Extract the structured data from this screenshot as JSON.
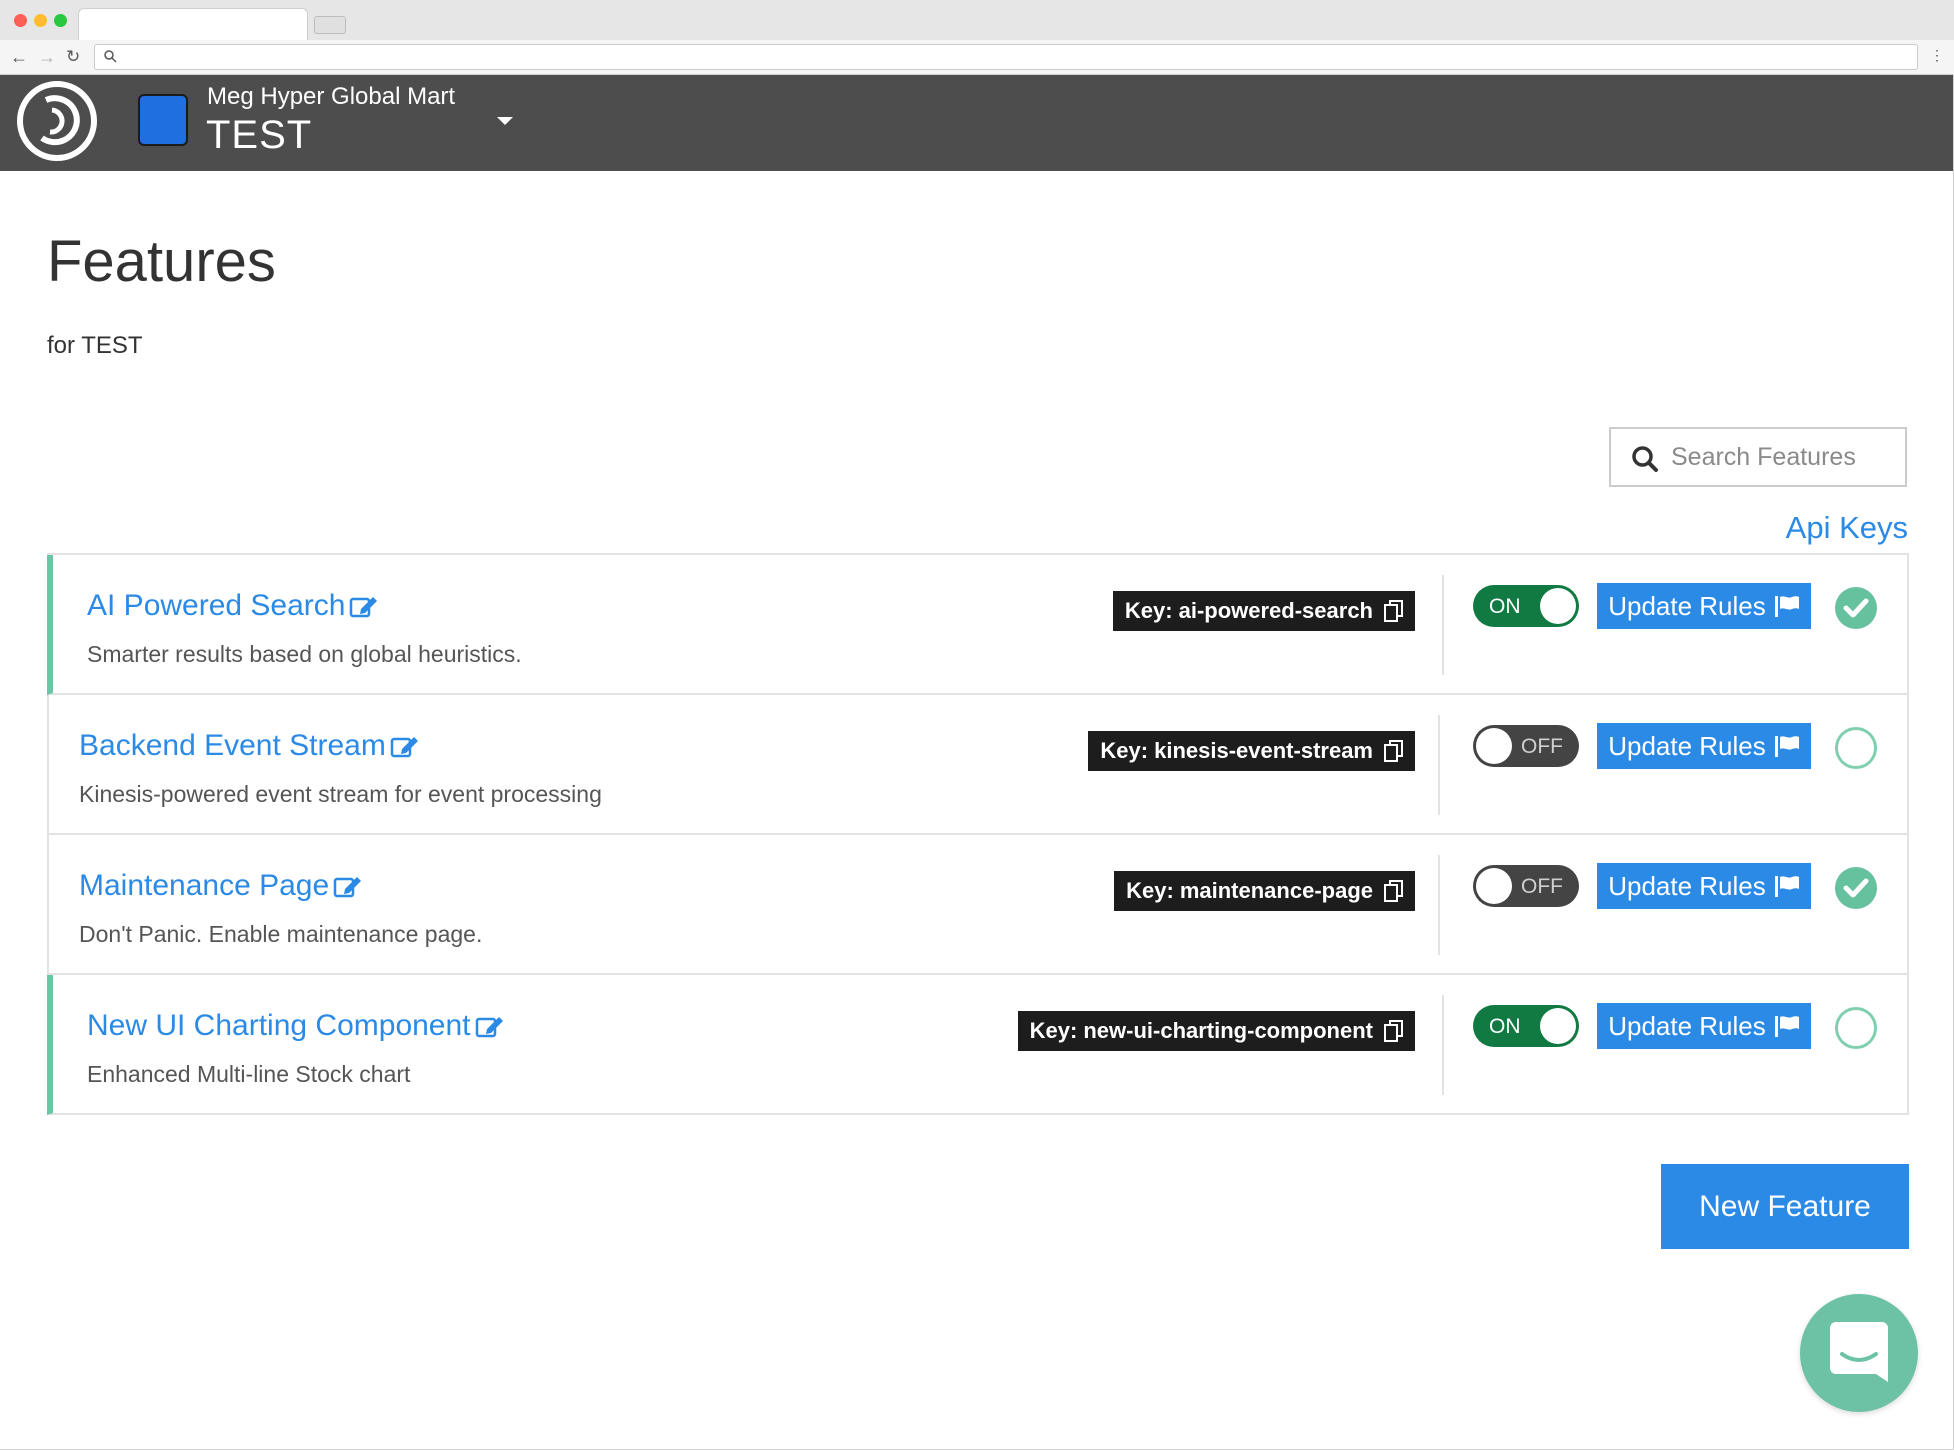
{
  "app": {
    "org_name": "Meg Hyper Global Mart",
    "environment": "TEST",
    "brand_color": "#1e6fe0",
    "header_color": "#4d4d4d",
    "accent_color": "#2b8ae6",
    "success_color": "#66c19e",
    "on_color": "#117a43"
  },
  "page": {
    "title": "Features",
    "subtitle": "for TEST"
  },
  "search": {
    "placeholder": "Search Features",
    "value": ""
  },
  "links": {
    "api_keys": "Api Keys"
  },
  "features": [
    {
      "title": "AI Powered Search",
      "description": "Smarter results based on global heuristics.",
      "key_prefix": "Key:",
      "key": "ai-powered-search",
      "toggle_label": "ON",
      "enabled": true,
      "update_label": "Update Rules",
      "checked": true,
      "highlighted": true
    },
    {
      "title": "Backend Event Stream",
      "description": "Kinesis-powered event stream for event processing",
      "key_prefix": "Key:",
      "key": "kinesis-event-stream",
      "toggle_label": "OFF",
      "enabled": false,
      "update_label": "Update Rules",
      "checked": false,
      "highlighted": false
    },
    {
      "title": "Maintenance Page",
      "description": "Don't Panic. Enable maintenance page.",
      "key_prefix": "Key:",
      "key": "maintenance-page",
      "toggle_label": "OFF",
      "enabled": false,
      "update_label": "Update Rules",
      "checked": true,
      "highlighted": false
    },
    {
      "title": "New UI Charting Component",
      "description": "Enhanced Multi-line Stock chart",
      "key_prefix": "Key:",
      "key": "new-ui-charting-component",
      "toggle_label": "ON",
      "enabled": true,
      "update_label": "Update Rules",
      "checked": false,
      "highlighted": true
    }
  ],
  "actions": {
    "new_feature": "New Feature"
  },
  "icons": {
    "logo": "app-logo-icon",
    "edit": "edit-icon",
    "copy": "copy-icon",
    "flag": "flag-icon",
    "check": "check-icon",
    "search": "search-icon",
    "chat": "chat-icon",
    "caret": "caret-down-icon"
  }
}
